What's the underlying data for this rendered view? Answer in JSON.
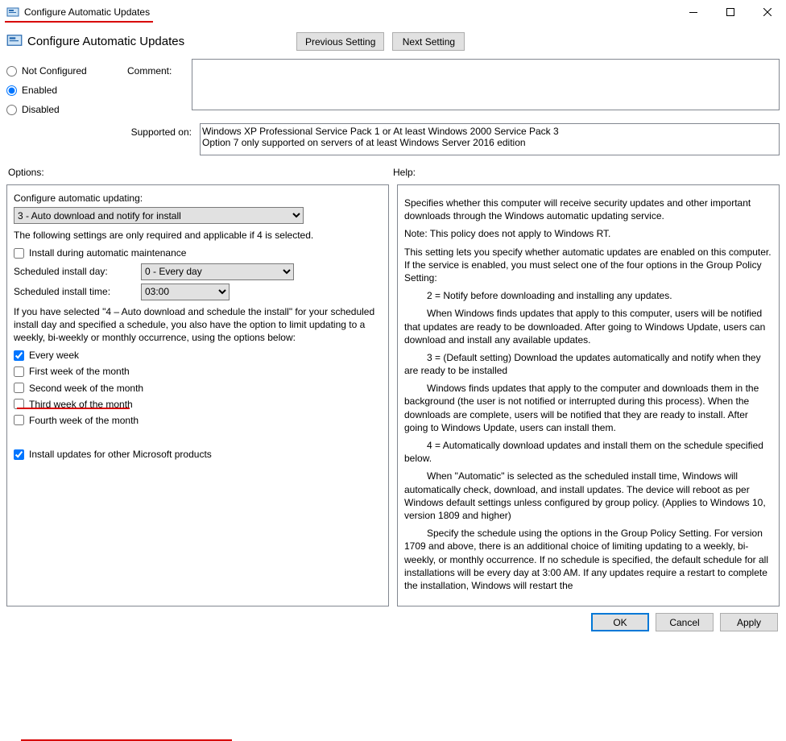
{
  "window": {
    "title": "Configure Automatic Updates"
  },
  "header": {
    "title": "Configure Automatic Updates",
    "prev_btn": "Previous Setting",
    "next_btn": "Next Setting"
  },
  "state": {
    "not_configured": "Not Configured",
    "enabled": "Enabled",
    "disabled": "Disabled",
    "selected": "enabled"
  },
  "comment": {
    "label": "Comment:",
    "value": ""
  },
  "supported": {
    "label": "Supported on:",
    "value": "Windows XP Professional Service Pack 1 or At least Windows 2000 Service Pack 3\nOption 7 only supported on servers of at least Windows Server 2016 edition"
  },
  "section_labels": {
    "options": "Options:",
    "help": "Help:"
  },
  "options": {
    "configure_label": "Configure automatic updating:",
    "configure_value": "3 - Auto download and notify for install",
    "note1": "The following settings are only required and applicable if 4 is selected.",
    "install_maint": {
      "label": "Install during automatic maintenance",
      "checked": false
    },
    "sched_day_label": "Scheduled install day:",
    "sched_day_value": "0 - Every day",
    "sched_time_label": "Scheduled install time:",
    "sched_time_value": "03:00",
    "note2": "If you have selected \"4 – Auto download and schedule the install\" for your scheduled install day and specified a schedule, you also have the option to limit updating to a weekly, bi-weekly or monthly occurrence, using the options below:",
    "every_week": {
      "label": "Every week",
      "checked": true
    },
    "first_week": {
      "label": "First week of the month",
      "checked": false
    },
    "second_week": {
      "label": "Second week of the month",
      "checked": false
    },
    "third_week": {
      "label": "Third week of the month",
      "checked": false
    },
    "fourth_week": {
      "label": "Fourth week of the month",
      "checked": false
    },
    "other_products": {
      "label": "Install updates for other Microsoft products",
      "checked": true
    }
  },
  "help": {
    "p1": "Specifies whether this computer will receive security updates and other important downloads through the Windows automatic updating service.",
    "p2": "Note: This policy does not apply to Windows RT.",
    "p3": "This setting lets you specify whether automatic updates are enabled on this computer. If the service is enabled, you must select one of the four options in the Group Policy Setting:",
    "o2": "2 = Notify before downloading and installing any updates.",
    "o2b": "When Windows finds updates that apply to this computer, users will be notified that updates are ready to be downloaded. After going to Windows Update, users can download and install any available updates.",
    "o3": "3 = (Default setting) Download the updates automatically and notify when they are ready to be installed",
    "o3b": "Windows finds updates that apply to the computer and downloads them in the background (the user is not notified or interrupted during this process). When the downloads are complete, users will be notified that they are ready to install. After going to Windows Update, users can install them.",
    "o4": "4 = Automatically download updates and install them on the schedule specified below.",
    "o4b": "When \"Automatic\" is selected as the scheduled install time, Windows will automatically check, download, and install updates. The device will reboot as per Windows default settings unless configured by group policy. (Applies to Windows 10, version 1809 and higher)",
    "o4c": "Specify the schedule using the options in the Group Policy Setting. For version 1709 and above, there is an additional choice of limiting updating to a weekly, bi-weekly, or monthly occurrence. If no schedule is specified, the default schedule for all installations will be every day at 3:00 AM. If any updates require a restart to complete the installation, Windows will restart the"
  },
  "footer": {
    "ok": "OK",
    "cancel": "Cancel",
    "apply": "Apply"
  }
}
